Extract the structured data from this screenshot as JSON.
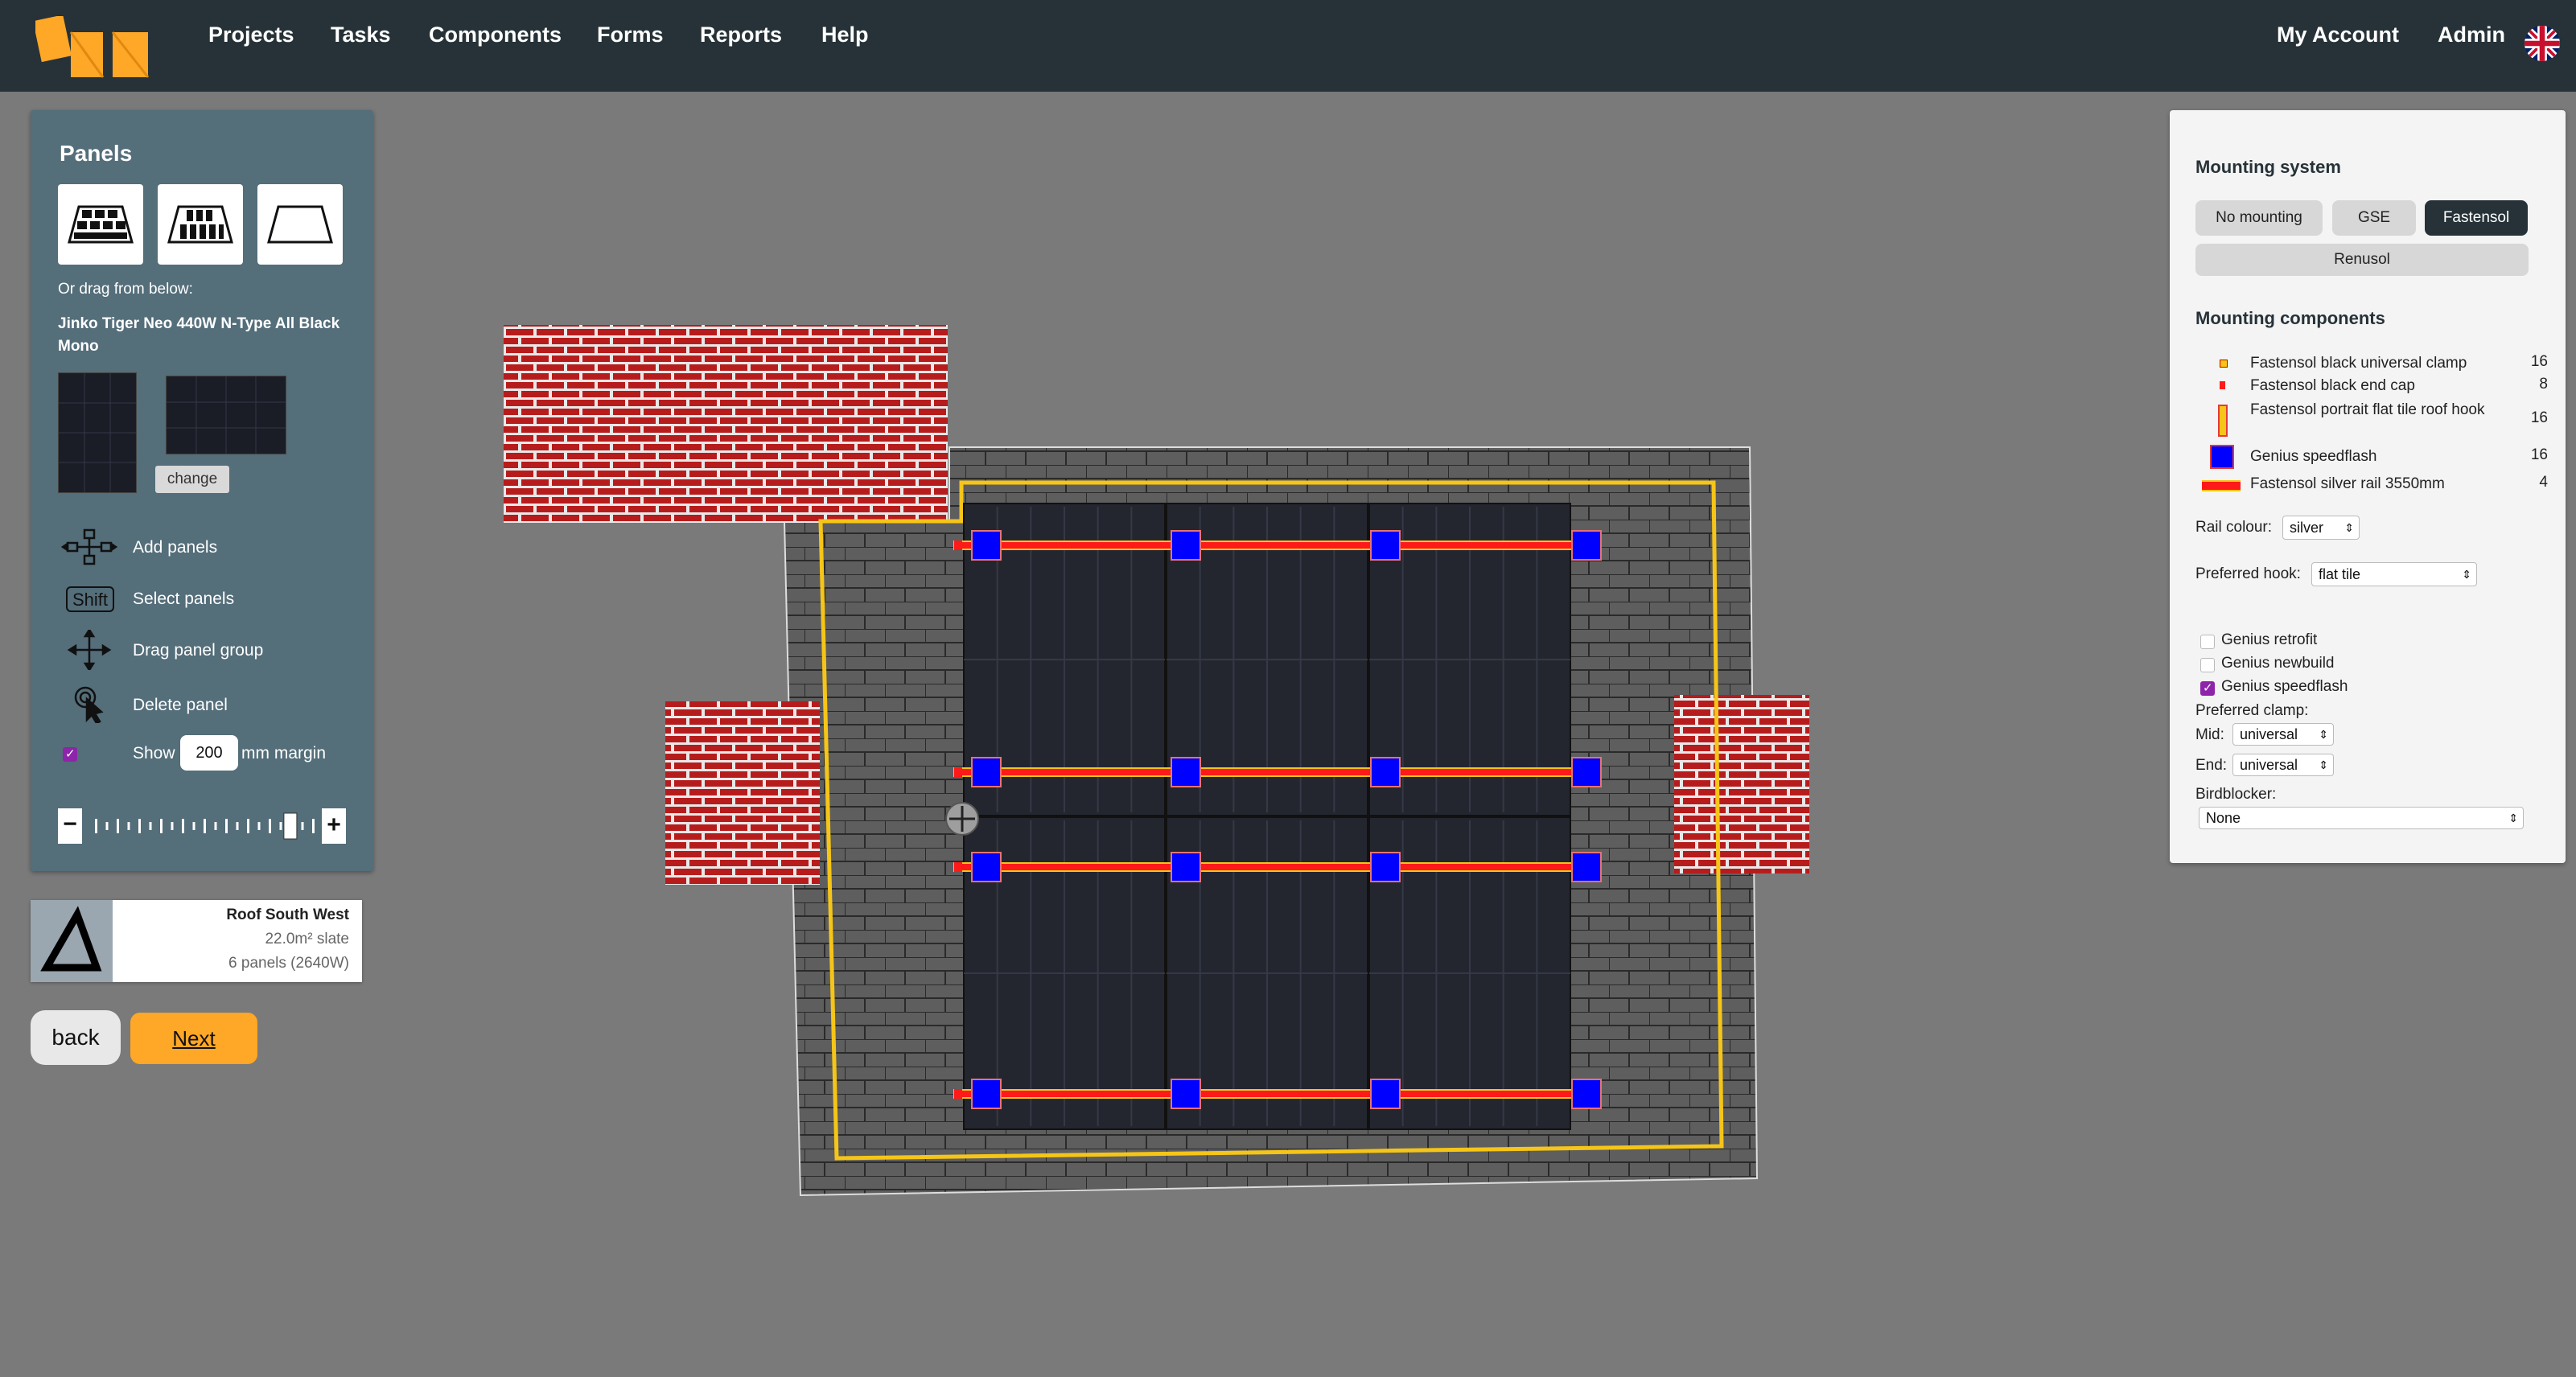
{
  "nav": {
    "items": [
      "Projects",
      "Tasks",
      "Components",
      "Forms",
      "Reports",
      "Help"
    ],
    "account": "My Account",
    "admin": "Admin",
    "language_icon": "uk-flag-icon"
  },
  "panels_tool": {
    "title": "Panels",
    "drag_hint": "Or drag from below:",
    "panel_model": "Jinko Tiger Neo 440W N-Type All Black Mono",
    "change_label": "change",
    "instructions": {
      "add": "Add panels",
      "shift_key": "Shift",
      "select": "Select panels",
      "drag": "Drag panel group",
      "delete": "Delete panel",
      "show": "Show",
      "margin_value": "200",
      "margin_suffix": "mm margin"
    },
    "show_margin_checked": true,
    "zoom_minus": "−",
    "zoom_plus": "+",
    "zoom_level": 0.83
  },
  "roof": {
    "name": "Roof South West",
    "area": "22.0m² slate",
    "panels": "6 panels (2640W)"
  },
  "buttons": {
    "back": "back",
    "next": "Next"
  },
  "mounting": {
    "title": "Mounting system",
    "options": [
      "No mounting",
      "GSE",
      "Fastensol",
      "Renusol"
    ],
    "selected": "Fastensol",
    "components_title": "Mounting components",
    "components": [
      {
        "name": "Fastensol black universal clamp",
        "qty": "16",
        "icon": "universal-clamp-icon"
      },
      {
        "name": "Fastensol black end cap",
        "qty": "8",
        "icon": "end-cap-icon"
      },
      {
        "name": "Fastensol portrait flat tile roof hook",
        "qty": "16",
        "icon": "roof-hook-icon"
      },
      {
        "name": "Genius speedflash",
        "qty": "16",
        "icon": "speedflash-icon"
      },
      {
        "name": "Fastensol silver rail 3550mm",
        "qty": "4",
        "icon": "rail-icon"
      }
    ],
    "rail_colour_label": "Rail colour:",
    "rail_colour": "silver",
    "preferred_hook_label": "Preferred hook:",
    "preferred_hook": "flat tile",
    "genius": [
      {
        "label": "Genius retrofit",
        "checked": false
      },
      {
        "label": "Genius newbuild",
        "checked": false
      },
      {
        "label": "Genius speedflash",
        "checked": true
      }
    ],
    "preferred_clamp_label": "Preferred clamp:",
    "mid_label": "Mid:",
    "mid_value": "universal",
    "end_label": "End:",
    "end_value": "universal",
    "birdblocker_label": "Birdblocker:",
    "birdblocker_value": "None"
  },
  "colors": {
    "nav_bg": "#263238",
    "canvas_bg": "#7a7a7a",
    "accent_orange": "#ffa726",
    "speedflash_blue": "#0000ff",
    "rail_red": "#ff1a1a",
    "margin_yellow": "#f5c518"
  }
}
